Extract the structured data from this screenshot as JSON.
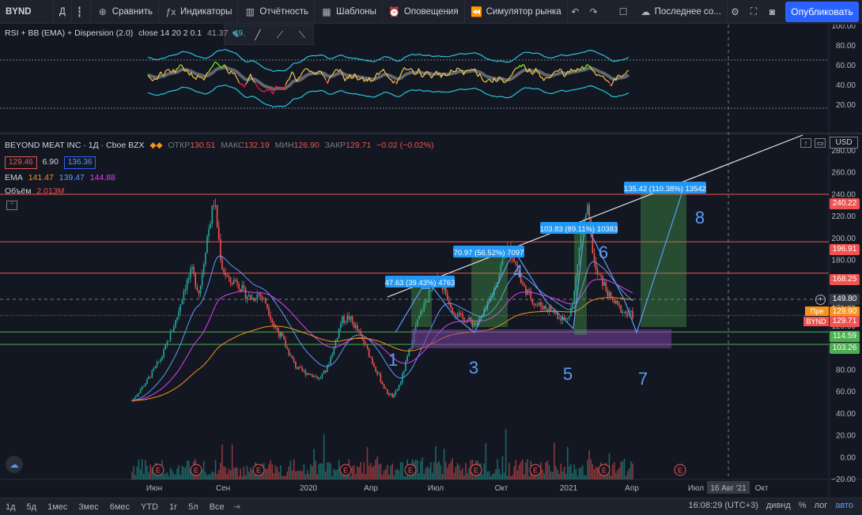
{
  "toolbar": {
    "symbol": "BYND",
    "interval": "Д",
    "compare": "Сравнить",
    "indicators": "Индикаторы",
    "financials": "Отчётность",
    "templates": "Шаблоны",
    "alerts": "Оповещения",
    "replay": "Симулятор рынка",
    "layout": "Последнее со...",
    "publish": "Опубликовать"
  },
  "rsi_panel": {
    "title": "RSI + BB (EMA) + Dispersion (2.0)",
    "params": "close 14 20 2 0.1",
    "val1": "41.37",
    "val2": "49.",
    "levels": [
      "100.00",
      "80.00",
      "60.00",
      "40.00",
      "20.00"
    ]
  },
  "main_legend": {
    "title": "BEYOND MEAT INC · 1Д · Cboe BZX",
    "open_lbl": "ОТКР",
    "open": "130.51",
    "high_lbl": "МАКС",
    "high": "132.19",
    "low_lbl": "МИН",
    "low": "126.90",
    "close_lbl": "ЗАКР",
    "close": "129.71",
    "change": "−0.02 (−0.02%)",
    "box1": "129.46",
    "box_mid": "6.90",
    "box2": "136.36",
    "ema_lbl": "EMA",
    "ema1": "141.47",
    "ema2": "139.47",
    "ema3": "144.88",
    "vol_lbl": "Объём",
    "vol": "2.013M"
  },
  "price_axis": {
    "currency": "USD",
    "ticks": [
      "280.00",
      "260.00",
      "240.00",
      "220.00",
      "200.00",
      "180.00",
      "160.00",
      "140.00",
      "120.00",
      "100.00",
      "80.00",
      "60.00",
      "40.00",
      "20.00",
      "0.00",
      "−20.00"
    ],
    "tags": {
      "t240": "240.22",
      "t196": "196.91",
      "t168": "168.25",
      "t149": "149.80",
      "pre_lbl": "Пре",
      "pre": "129.90",
      "bynd_lbl": "BYND",
      "bynd": "129.71",
      "t114": "114.59",
      "t103": "103.26"
    }
  },
  "time_axis": {
    "labels": [
      "Июн",
      "Сен",
      "2020",
      "Апр",
      "Июл",
      "Окт",
      "2021",
      "Апр",
      "Июл",
      "Окт"
    ],
    "crosshair": "16 Авг '21"
  },
  "annotations": {
    "waves": [
      "1",
      "2",
      "3",
      "4",
      "5",
      "6",
      "7",
      "8"
    ],
    "measures": [
      "47.63 (39.43%) 4763",
      "70.97 (56.52%) 7097",
      "103.83 (89.11%) 10383",
      "135.42 (110.38%) 13542"
    ]
  },
  "earnings_marker": "E",
  "bottombar": {
    "ranges": [
      "1д",
      "5д",
      "1мес",
      "3мес",
      "6мес",
      "YTD",
      "1г",
      "5л",
      "Все"
    ],
    "time": "16:08:29 (UTC+3)",
    "div": "дивнд",
    "pct": "%",
    "log": "лог",
    "auto": "авто"
  },
  "colors": {
    "bg": "#131722",
    "up": "#26a69a",
    "down": "#ef5350",
    "accent": "#2962ff"
  },
  "chart_data": {
    "type": "candlestick",
    "title": "BEYOND MEAT INC · 1Д · Cboe BZX",
    "ylim": [
      -20,
      290
    ],
    "horizontal_levels": [
      240.22,
      196.91,
      168.25,
      149.8,
      114.59,
      103.26
    ],
    "close_path": [
      [
        0,
        52
      ],
      [
        2,
        70
      ],
      [
        4,
        92
      ],
      [
        5,
        110
      ],
      [
        6,
        128
      ],
      [
        7,
        155
      ],
      [
        8,
        170
      ],
      [
        9,
        150
      ],
      [
        10,
        200
      ],
      [
        11,
        235
      ],
      [
        12,
        175
      ],
      [
        13,
        160
      ],
      [
        14,
        162
      ],
      [
        15,
        150
      ],
      [
        16,
        145
      ],
      [
        17,
        150
      ],
      [
        18,
        140
      ],
      [
        19,
        120
      ],
      [
        20,
        110
      ],
      [
        21,
        95
      ],
      [
        22,
        82
      ],
      [
        23,
        78
      ],
      [
        24,
        76
      ],
      [
        25,
        72
      ],
      [
        26,
        80
      ],
      [
        27,
        100
      ],
      [
        28,
        125
      ],
      [
        29,
        128
      ],
      [
        30,
        118
      ],
      [
        31,
        105
      ],
      [
        32,
        90
      ],
      [
        33,
        75
      ],
      [
        34,
        60
      ],
      [
        35,
        55
      ],
      [
        36,
        70
      ],
      [
        37,
        95
      ],
      [
        38,
        120
      ],
      [
        39,
        138
      ],
      [
        40,
        152
      ],
      [
        41,
        165
      ],
      [
        42,
        150
      ],
      [
        43,
        135
      ],
      [
        44,
        128
      ],
      [
        45,
        125
      ],
      [
        46,
        122
      ],
      [
        47,
        130
      ],
      [
        48,
        145
      ],
      [
        49,
        165
      ],
      [
        50,
        190
      ],
      [
        51,
        185
      ],
      [
        52,
        160
      ],
      [
        53,
        150
      ],
      [
        54,
        140
      ],
      [
        55,
        138
      ],
      [
        56,
        135
      ],
      [
        57,
        130
      ],
      [
        58,
        125
      ],
      [
        59,
        140
      ],
      [
        60,
        200
      ],
      [
        61,
        225
      ],
      [
        62,
        170
      ],
      [
        63,
        160
      ],
      [
        64,
        145
      ],
      [
        65,
        138
      ],
      [
        66,
        132
      ],
      [
        67,
        130
      ]
    ]
  }
}
